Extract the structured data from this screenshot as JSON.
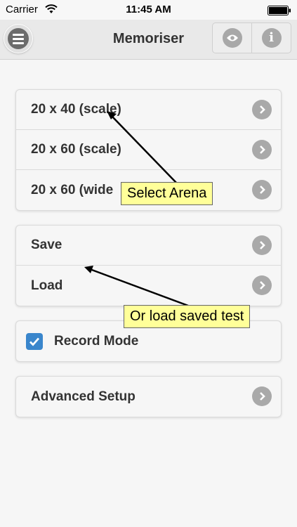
{
  "status_bar": {
    "carrier": "Carrier",
    "time": "11:45 AM"
  },
  "header": {
    "title": "Memoriser",
    "menu_icon": "hamburger-menu-icon",
    "eye_icon": "eye-icon",
    "info_icon": "info-icon",
    "info_glyph": "i"
  },
  "arenas": {
    "items": [
      {
        "label": "20 x 40 (scale)"
      },
      {
        "label": "20 x 60 (scale)"
      },
      {
        "label": "20 x 60 (wide"
      }
    ]
  },
  "files": {
    "save_label": "Save",
    "load_label": "Load"
  },
  "record": {
    "label": "Record Mode",
    "checked": true
  },
  "advanced": {
    "label": "Advanced Setup"
  },
  "callouts": {
    "select_arena": "Select Arena",
    "load_saved": "Or load saved test"
  },
  "colors": {
    "callout_bg": "#ffff99",
    "checkbox": "#3a86cc",
    "chevron": "#a9a9a9"
  }
}
